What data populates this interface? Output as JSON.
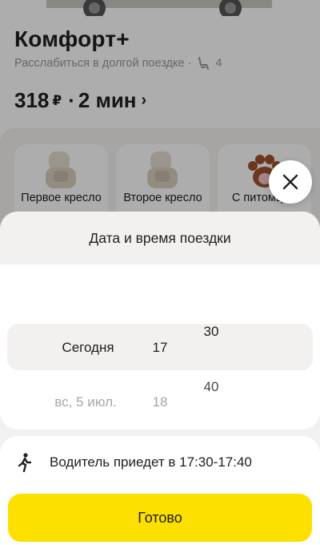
{
  "tariff": {
    "name": "Комфорт+",
    "subtitle": "Расслабиться в долгой поездке ·",
    "seats": "4",
    "price": "318",
    "currency": "₽",
    "separator": "·",
    "eta": "2 мин"
  },
  "options": [
    {
      "label": "Первое кресло",
      "icon": "child-seat-icon"
    },
    {
      "label": "Второе кресло",
      "icon": "child-seat-icon"
    },
    {
      "label": "С питомцем",
      "icon": "paw-icon"
    }
  ],
  "sheet": {
    "title": "Дата и время поездки",
    "picker": {
      "day_selected": "Сегодня",
      "day_next": "вс, 5 июл.",
      "hour_selected": "17",
      "hour_next": "18",
      "minute_selected": "30",
      "minute_next": "40"
    },
    "info": "Водитель приедет в 17:30-17:40",
    "done_label": "Готово"
  },
  "colors": {
    "accent_yellow": "#fce000",
    "sheet_bg": "#f2f1ef",
    "text": "#21201f",
    "muted": "#a8a6a2"
  }
}
